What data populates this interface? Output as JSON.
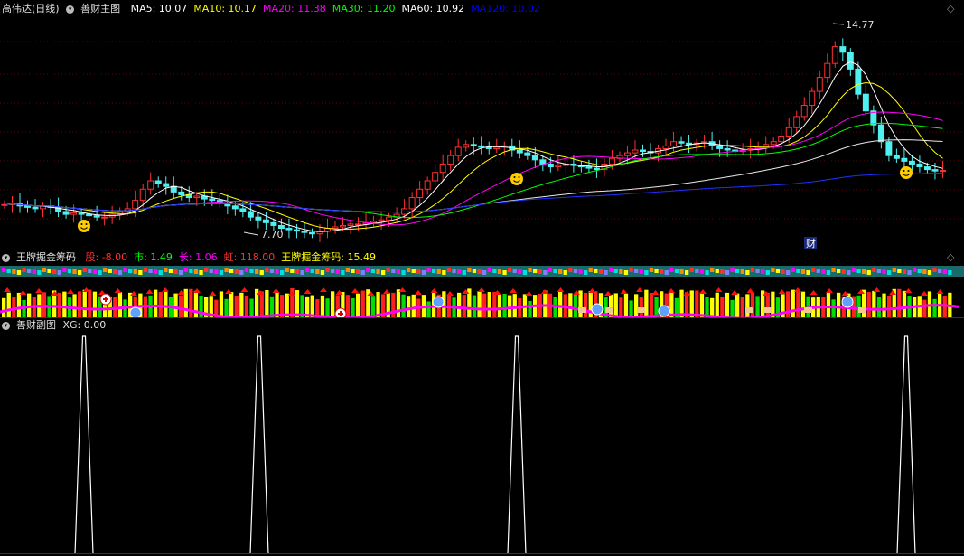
{
  "main_panel": {
    "stock_name": "高伟达(日线)",
    "indicator_name": "善财主图",
    "ma": [
      {
        "label": "MA5: 10.07",
        "color": "#ffffff"
      },
      {
        "label": "MA10: 10.17",
        "color": "#ffff00"
      },
      {
        "label": "MA20: 11.38",
        "color": "#ff00ff"
      },
      {
        "label": "MA30: 11.20",
        "color": "#00ff00"
      },
      {
        "label": "MA60: 10.92",
        "color": "#ffffff"
      },
      {
        "label": "MA120: 10.02",
        "color": "#0000ff"
      }
    ],
    "high_label": "14.77",
    "low_label": "7.70",
    "cai_badge": "财"
  },
  "sub_panel_1": {
    "indicator_name": "王牌掘金筹码",
    "values": [
      {
        "label": "股: -8.00",
        "color": "#ff3030"
      },
      {
        "label": "市: 1.49",
        "color": "#00ff00"
      },
      {
        "label": "长: 1.06",
        "color": "#ff00ff"
      },
      {
        "label": "虹: 118.00",
        "color": "#ff3030"
      },
      {
        "label": "王牌掘金筹码: 15.49",
        "color": "#ffff00"
      }
    ]
  },
  "sub_panel_2": {
    "indicator_name": "善财副图",
    "xg_label": "XG: 0.00"
  },
  "chart_data": [
    {
      "type": "candlestick",
      "title": "高伟达(日线)",
      "y_range": [
        7.5,
        15.2
      ],
      "high": 14.77,
      "low": 7.7,
      "close_series": [
        8.85,
        8.9,
        8.8,
        8.75,
        8.7,
        8.8,
        8.75,
        8.6,
        8.5,
        8.55,
        8.5,
        8.45,
        8.4,
        8.4,
        8.5,
        8.6,
        8.7,
        9.0,
        9.4,
        9.7,
        9.6,
        9.5,
        9.3,
        9.2,
        9.1,
        9.15,
        9.05,
        9.0,
        8.9,
        8.8,
        8.7,
        8.6,
        8.4,
        8.3,
        8.2,
        8.1,
        8.0,
        7.95,
        7.9,
        7.85,
        7.8,
        7.9,
        8.0,
        8.05,
        8.1,
        8.15,
        8.15,
        8.2,
        8.25,
        8.3,
        8.4,
        8.5,
        8.7,
        9.1,
        9.4,
        9.7,
        10.0,
        10.3,
        10.6,
        10.9,
        11.0,
        10.95,
        10.9,
        10.85,
        10.9,
        10.95,
        10.8,
        10.7,
        10.6,
        10.45,
        10.3,
        10.2,
        10.25,
        10.3,
        10.25,
        10.2,
        10.15,
        10.1,
        10.3,
        10.5,
        10.6,
        10.7,
        10.8,
        10.75,
        10.7,
        10.85,
        10.95,
        11.1,
        11.05,
        11.0,
        11.05,
        11.1,
        10.95,
        10.85,
        10.8,
        10.75,
        10.8,
        10.85,
        10.9,
        11.0,
        11.1,
        11.3,
        11.6,
        12.0,
        12.4,
        12.9,
        13.4,
        13.9,
        14.5,
        14.3,
        13.7,
        12.8,
        12.2,
        11.7,
        11.1,
        10.6,
        10.5,
        10.4,
        10.3,
        10.2,
        10.1,
        10.05,
        10.07
      ],
      "ma_series": [
        "MA5",
        "MA10",
        "MA20",
        "MA30",
        "MA60",
        "MA120"
      ]
    },
    {
      "type": "bar",
      "title": "王牌掘金筹码",
      "y_range": [
        0,
        100
      ],
      "bars": [
        {
          "color": "#ffff00",
          "value": 60
        },
        {
          "color": "#ffff00",
          "value": 65
        },
        {
          "color": "#ff2020",
          "value": 55
        },
        {
          "color": "#ffff00",
          "value": 68
        },
        {
          "color": "#00dd00",
          "value": 50
        },
        {
          "color": "#ffff00",
          "value": 70
        },
        {
          "color": "#ff2020",
          "value": 62
        },
        {
          "color": "#ffff00",
          "value": 72
        },
        {
          "color": "#ff2020",
          "value": 66
        },
        {
          "color": "#00dd00",
          "value": 58
        },
        {
          "color": "#ffff00",
          "value": 74
        },
        {
          "color": "#ff2020",
          "value": 70
        },
        {
          "color": "#ffff00",
          "value": 75
        },
        {
          "color": "#00dd00",
          "value": 60
        },
        {
          "color": "#ffff00",
          "value": 72
        },
        {
          "color": "#ff2020",
          "value": 68
        },
        {
          "color": "#ffff00",
          "value": 74
        },
        {
          "color": "#ff2020",
          "value": 76
        },
        {
          "color": "#ffff00",
          "value": 73
        },
        {
          "color": "#00dd00",
          "value": 62
        }
      ]
    },
    {
      "type": "line",
      "title": "善财副图",
      "y_range": [
        0,
        1
      ],
      "spike_positions": [
        93,
        287,
        572,
        1003
      ],
      "values_at_spikes": [
        1,
        1,
        1,
        1
      ]
    }
  ]
}
